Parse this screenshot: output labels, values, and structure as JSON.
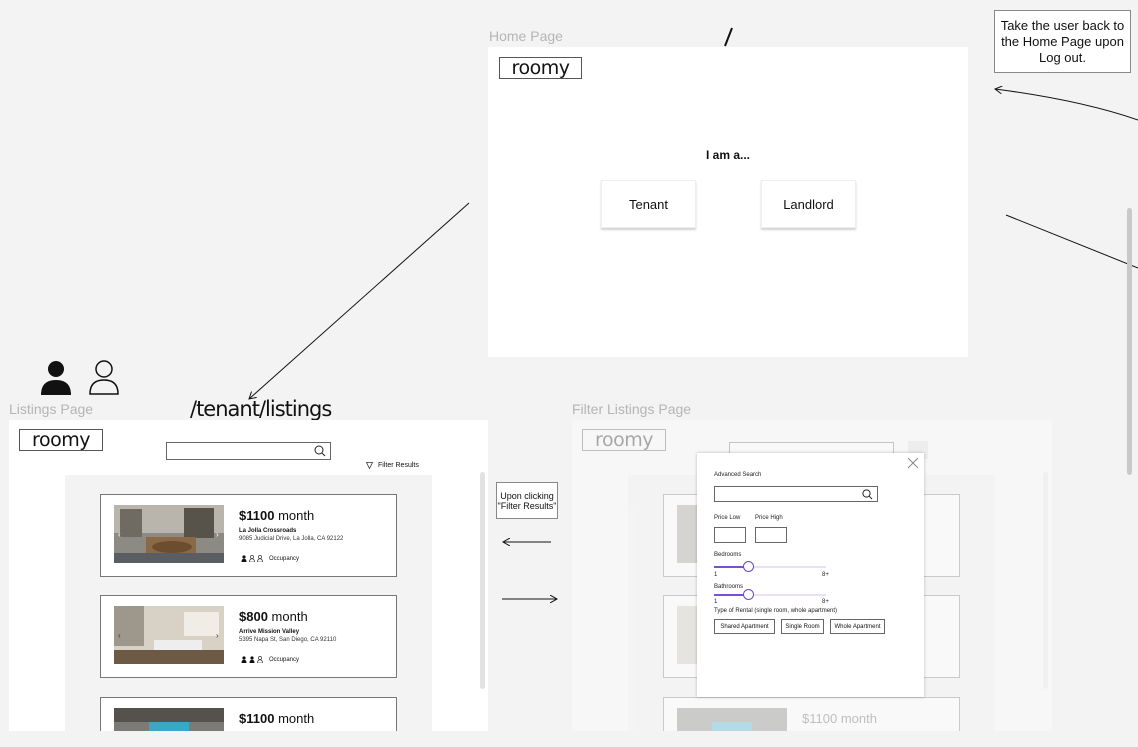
{
  "home": {
    "frame_label": "Home Page",
    "route": "/",
    "logo": "roomy",
    "prompt": "I am a...",
    "tenant_label": "Tenant",
    "landlord_label": "Landlord"
  },
  "notes": {
    "logout": "Take the user back to the Home Page upon Log out.",
    "filter": "Upon clicking \"Filter Results\""
  },
  "listings": {
    "frame_label": "Listings Page",
    "route": "/tenant/listings",
    "logo": "roomy",
    "filter_label": "Filter Results",
    "cards": [
      {
        "price": "$1100",
        "unit": "month",
        "name": "La Jolla Crossroads",
        "address": "9085 Judicial Drive, La Jolla, CA 92122",
        "occupancy": "Occupancy",
        "filled": 1
      },
      {
        "price": "$800",
        "unit": "month",
        "name": "Arrive Mission Valley",
        "address": "5395 Napa St, San Diego, CA 92110",
        "occupancy": "Occupancy",
        "filled": 2
      },
      {
        "price": "$1100",
        "unit": "month"
      }
    ]
  },
  "filter_page": {
    "frame_label": "Filter Listings Page",
    "logo": "roomy",
    "bottom_price": "$1100",
    "bottom_unit": "month",
    "modal": {
      "title": "Advanced Search",
      "price_low": "Price Low",
      "price_high": "Price High",
      "bedrooms": "Bedrooms",
      "bedrooms_min": "1",
      "bedrooms_max": "8+",
      "bathrooms": "Bathrooms",
      "bathrooms_min": "1",
      "bathrooms_max": "8+",
      "rental_type": "Type of Rental (single room, whole apartment)",
      "options": [
        "Shared Apartment",
        "Single Room",
        "Whole Apartment"
      ]
    }
  },
  "colors": {
    "accent": "#7b4fd4",
    "background": "#f3f3f3"
  }
}
